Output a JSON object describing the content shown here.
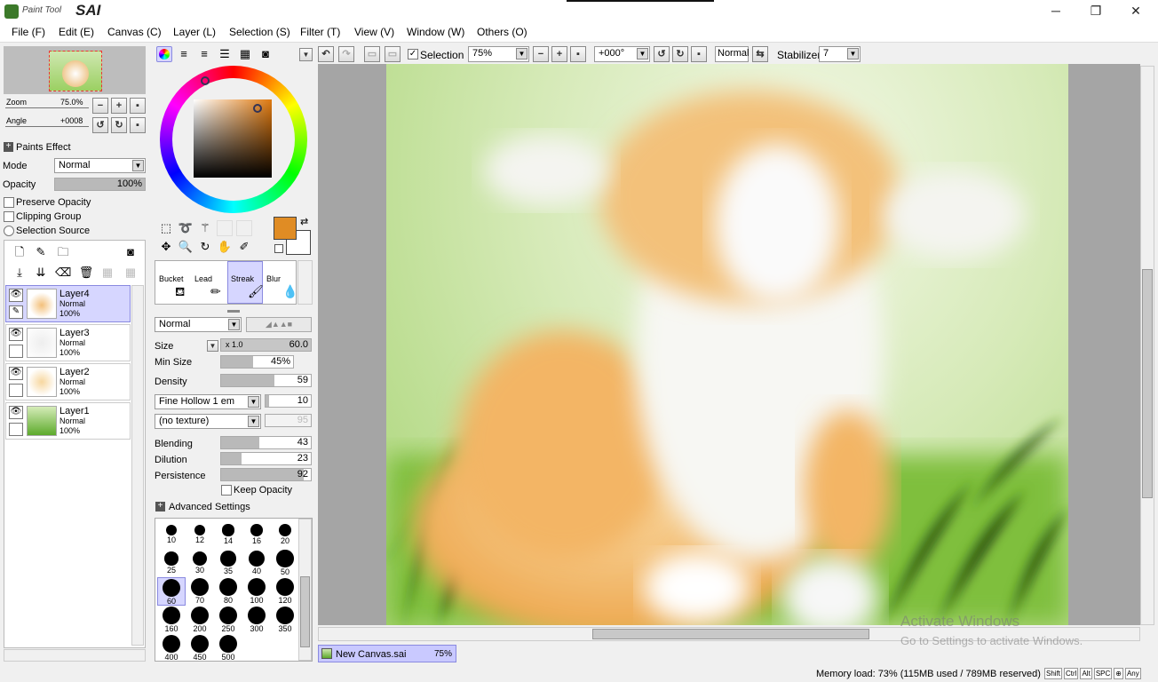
{
  "app": {
    "logo_small": "Paint Tool",
    "logo_big": "SAI"
  },
  "window_controls": {
    "minimize": "─",
    "maximize": "❐",
    "close": "✕"
  },
  "menu": [
    "File (F)",
    "Edit (E)",
    "Canvas (C)",
    "Layer (L)",
    "Selection (S)",
    "Filter (T)",
    "View (V)",
    "Window (W)",
    "Others (O)"
  ],
  "navigator": {
    "zoom_label": "Zoom",
    "zoom_value": "75.0%",
    "angle_label": "Angle",
    "angle_value": "+0008"
  },
  "paints_effect": {
    "header": "Paints Effect",
    "mode_label": "Mode",
    "mode_value": "Normal",
    "opacity_label": "Opacity",
    "opacity_value": "100%",
    "opacity_fraction": 1.0,
    "preserve_opacity": "Preserve Opacity",
    "clipping_group": "Clipping Group",
    "selection_source": "Selection Source"
  },
  "layers": [
    {
      "name": "Layer4",
      "mode": "Normal",
      "opacity": "100%",
      "active": true
    },
    {
      "name": "Layer3",
      "mode": "Normal",
      "opacity": "100%",
      "active": false
    },
    {
      "name": "Layer2",
      "mode": "Normal",
      "opacity": "100%",
      "active": false
    },
    {
      "name": "Layer1",
      "mode": "Normal",
      "opacity": "100%",
      "active": false
    }
  ],
  "tools": {
    "brushes": [
      "Bucket",
      "Lead",
      "Streak",
      "Blur"
    ],
    "brush_mode": "Normal"
  },
  "brush_settings": {
    "size_label": "Size",
    "size_multiplier": "x 1.0",
    "size_value": "60.0",
    "min_size_label": "Min Size",
    "min_size_value": "45%",
    "min_size_fraction": 0.45,
    "density_label": "Density",
    "density_value": "59",
    "density_fraction": 0.59,
    "shape_value": "Fine Hollow 1 em",
    "shape_amount": "10",
    "texture_value": "(no texture)",
    "texture_amount": "95",
    "blending_label": "Blending",
    "blending_value": "43",
    "blending_fraction": 0.43,
    "dilution_label": "Dilution",
    "dilution_value": "23",
    "dilution_fraction": 0.23,
    "persistence_label": "Persistence",
    "persistence_value": "92",
    "persistence_fraction": 0.92,
    "keep_opacity": "Keep Opacity",
    "advanced": "Advanced Settings"
  },
  "brush_sizes": [
    "10",
    "12",
    "14",
    "16",
    "20",
    "25",
    "30",
    "35",
    "40",
    "50",
    "60",
    "70",
    "80",
    "100",
    "120",
    "160",
    "200",
    "250",
    "300",
    "350",
    "400",
    "450",
    "500"
  ],
  "selected_brush_size": "60",
  "canvas_toolbar": {
    "selection_label": "Selection",
    "zoom": "75%",
    "angle": "+000°",
    "blend": "Normal",
    "stabilizer_label": "Stabilizer",
    "stabilizer_value": "7"
  },
  "canvas_tab": {
    "name": "New Canvas.sai",
    "zoom": "75%"
  },
  "watermark": {
    "line1": "Activate Windows",
    "line2": "Go to Settings to activate Windows."
  },
  "status": {
    "memory": "Memory load: 73% (115MB used / 789MB reserved)",
    "keys": [
      "Shift",
      "Ctrl",
      "Alt",
      "SPC",
      "⊕",
      "Any"
    ]
  }
}
